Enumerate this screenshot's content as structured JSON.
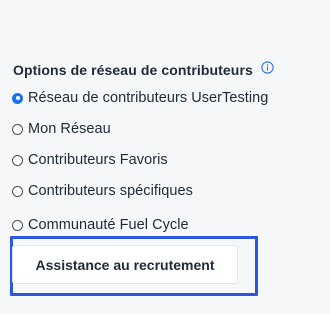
{
  "section": {
    "title": "Options de réseau de contributeurs",
    "info_icon": "info-icon",
    "accent_color": "#1a73e8"
  },
  "options": [
    {
      "label": "Réseau de contributeurs UserTesting",
      "checked": true
    },
    {
      "label": "Mon Réseau",
      "checked": false
    },
    {
      "label": "Contributeurs Favoris",
      "checked": false
    },
    {
      "label": "Contributeurs spécifiques",
      "checked": false
    },
    {
      "label": "Communauté Fuel Cycle",
      "checked": false
    }
  ],
  "recruit_button": {
    "label": "Assistance au recrutement",
    "focus_color": "#2b56e0"
  }
}
